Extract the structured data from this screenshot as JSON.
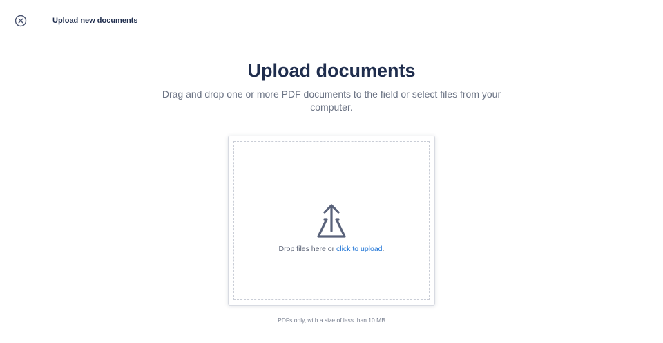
{
  "header": {
    "close_icon": "close-circle-icon",
    "title": "Upload new documents"
  },
  "main": {
    "heading": "Upload documents",
    "subtitle": "Drag and drop one or more PDF documents to the field or select files from your computer."
  },
  "dropzone": {
    "icon": "upload-icon",
    "text_prefix": "Drop files here or ",
    "link_text": "click to upload",
    "text_suffix": "."
  },
  "hint": "PDFs only, with a size of less than 10 MB",
  "colors": {
    "primary_text": "#1f2d4d",
    "link": "#1e74d6",
    "icon": "#59627a"
  }
}
